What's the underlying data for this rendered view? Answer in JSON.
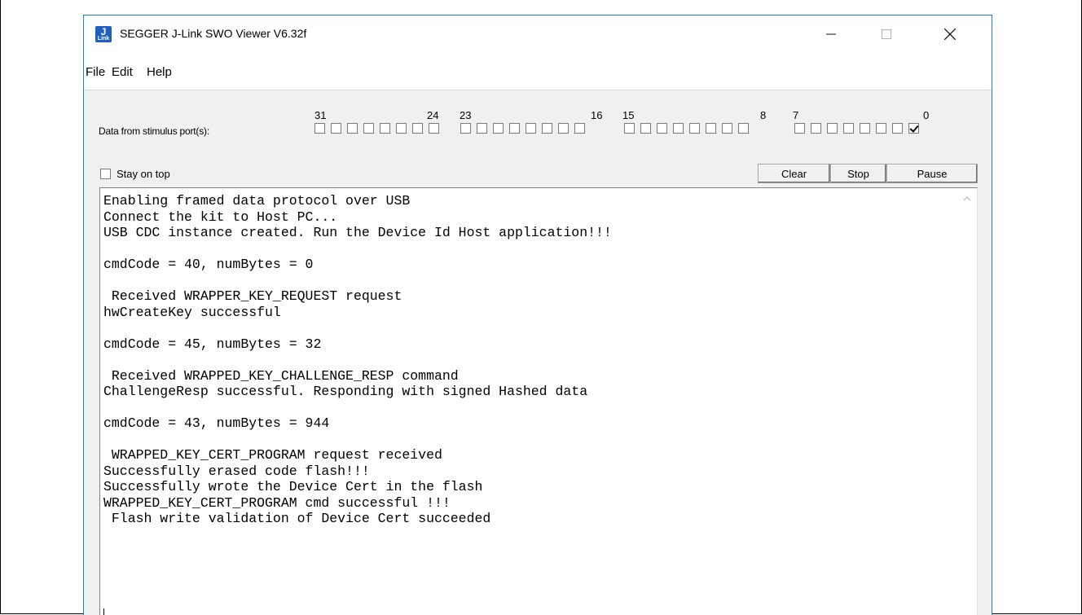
{
  "window": {
    "title": "SEGGER J-Link SWO Viewer V6.32f",
    "icon": "jlink-app-icon",
    "icon_text_top": "J",
    "icon_text_bottom": "Link",
    "controls": [
      "minimize",
      "maximize",
      "close"
    ]
  },
  "menu": {
    "items": [
      "File",
      "Edit",
      "Help"
    ]
  },
  "stimulus": {
    "label": "Data from stimulus port(s):",
    "group_labels": [
      {
        "high": "31",
        "low": "24"
      },
      {
        "high": "23",
        "low": "16"
      },
      {
        "high": "15",
        "low": "8"
      },
      {
        "high": "7",
        "low": "0"
      }
    ],
    "checked_ports": [
      0
    ]
  },
  "options": {
    "stay_on_top_label": "Stay on top",
    "stay_on_top_checked": false
  },
  "toolbar": {
    "clear_label": "Clear",
    "stop_label": "Stop",
    "pause_label": "Pause"
  },
  "output": {
    "lines": [
      "Enabling framed data protocol over USB",
      "Connect the kit to Host PC...",
      "USB CDC instance created. Run the Device Id Host application!!!",
      "",
      "cmdCode = 40, numBytes = 0",
      "",
      " Received WRAPPER_KEY_REQUEST request",
      "hwCreateKey successful",
      "",
      "cmdCode = 45, numBytes = 32",
      "",
      " Received WRAPPED_KEY_CHALLENGE_RESP command",
      "ChallengeResp successful. Responding with signed Hashed data",
      "",
      "cmdCode = 43, numBytes = 944",
      "",
      " WRAPPED_KEY_CERT_PROGRAM request received",
      "Successfully erased code flash!!!",
      "Successfully wrote the Device Cert in the flash",
      "WRAPPED_KEY_CERT_PROGRAM cmd successful !!!",
      " Flash write validation of Device Cert succeeded"
    ]
  },
  "colors": {
    "window_border": "#1883d7",
    "window_body": "#f0f0f0",
    "app_icon": "#1f5fbf"
  }
}
